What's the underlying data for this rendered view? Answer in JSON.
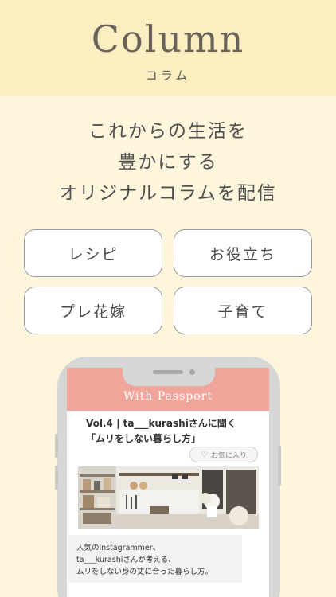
{
  "header": {
    "title": "Column",
    "subtitle": "コラム"
  },
  "tagline": {
    "line1": "これからの生活を",
    "line2": "豊かにする",
    "line3": "オリジナルコラムを配信"
  },
  "categories": [
    {
      "label": "レシピ"
    },
    {
      "label": "お役立ち"
    },
    {
      "label": "プレ花嫁"
    },
    {
      "label": "子育て"
    }
  ],
  "phone_app": {
    "app_name": "With Passport",
    "article_title_line1": "Vol.4 | ta___kurashiさんに聞く",
    "article_title_line2": "「ムリをしない暮らし方」",
    "favorite_label": "お気に入り",
    "favorite_icon": "heart-icon",
    "description_line1": "人気のinstagrammer、",
    "description_line2": "ta___kurashiさんが考える、",
    "description_line3": "ムリをしない身の丈に合った暮らし方。"
  },
  "colors": {
    "page_bg": "#fdf6dc",
    "header_bg": "#fbeec0",
    "app_bar": "#f1a49a"
  }
}
